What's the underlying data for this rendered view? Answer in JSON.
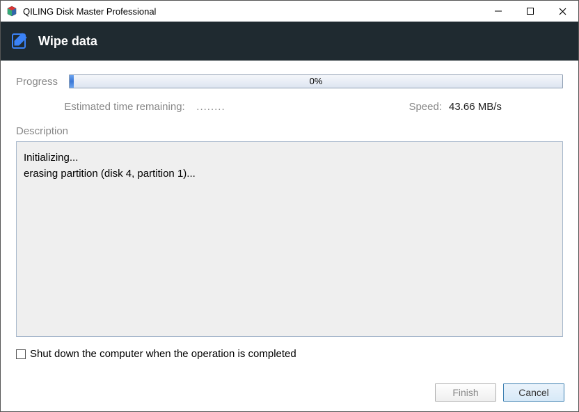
{
  "window": {
    "title": "QILING Disk Master Professional"
  },
  "header": {
    "title": "Wipe data"
  },
  "progress": {
    "label": "Progress",
    "percent_text": "0%",
    "eta_label": "Estimated time remaining:",
    "eta_value": "........",
    "speed_label": "Speed:",
    "speed_value": "43.66 MB/s"
  },
  "description": {
    "label": "Description",
    "log": "Initializing...\nerasing partition (disk 4, partition 1)..."
  },
  "options": {
    "shutdown_label": "Shut down the computer when the operation is completed"
  },
  "footer": {
    "finish_label": "Finish",
    "cancel_label": "Cancel"
  }
}
